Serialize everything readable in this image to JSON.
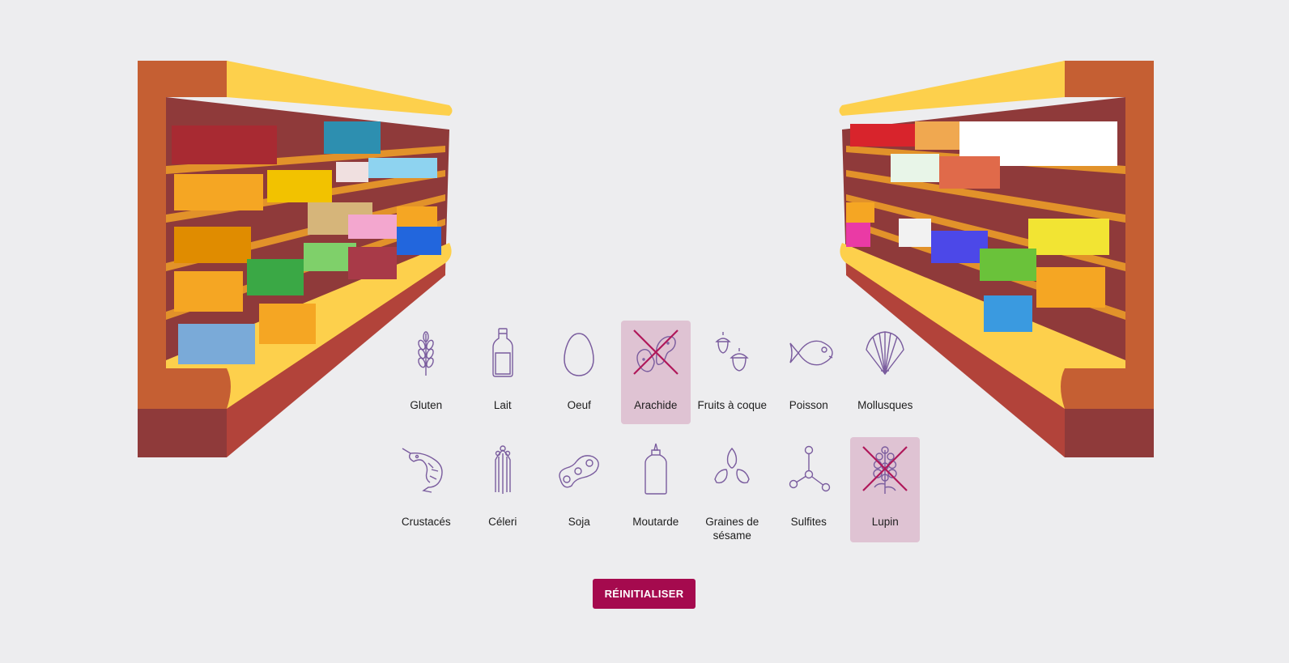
{
  "colors": {
    "accent": "#a50a4e",
    "selected_bg": "#dfc3d3",
    "icon_stroke": "#7a5c9e",
    "cross": "#b0185a",
    "background": "#ededef"
  },
  "allergens": [
    {
      "label": "Gluten",
      "icon": "wheat-icon",
      "selected": false
    },
    {
      "label": "Lait",
      "icon": "milk-bottle-icon",
      "selected": false
    },
    {
      "label": "Oeuf",
      "icon": "egg-icon",
      "selected": false
    },
    {
      "label": "Arachide",
      "icon": "peanut-icon",
      "selected": true
    },
    {
      "label": "Fruits à coque",
      "icon": "acorn-icon",
      "selected": false
    },
    {
      "label": "Poisson",
      "icon": "fish-icon",
      "selected": false
    },
    {
      "label": "Mollusques",
      "icon": "shell-icon",
      "selected": false
    },
    {
      "label": "Crustacés",
      "icon": "shrimp-icon",
      "selected": false
    },
    {
      "label": "Céleri",
      "icon": "celery-icon",
      "selected": false
    },
    {
      "label": "Soja",
      "icon": "soy-icon",
      "selected": false
    },
    {
      "label": "Moutarde",
      "icon": "mustard-bottle-icon",
      "selected": false
    },
    {
      "label": "Graines de sésame",
      "icon": "sesame-icon",
      "selected": false
    },
    {
      "label": "Sulfites",
      "icon": "molecule-icon",
      "selected": false
    },
    {
      "label": "Lupin",
      "icon": "lupin-icon",
      "selected": true
    }
  ],
  "reset_label": "RÉINITIALISER"
}
